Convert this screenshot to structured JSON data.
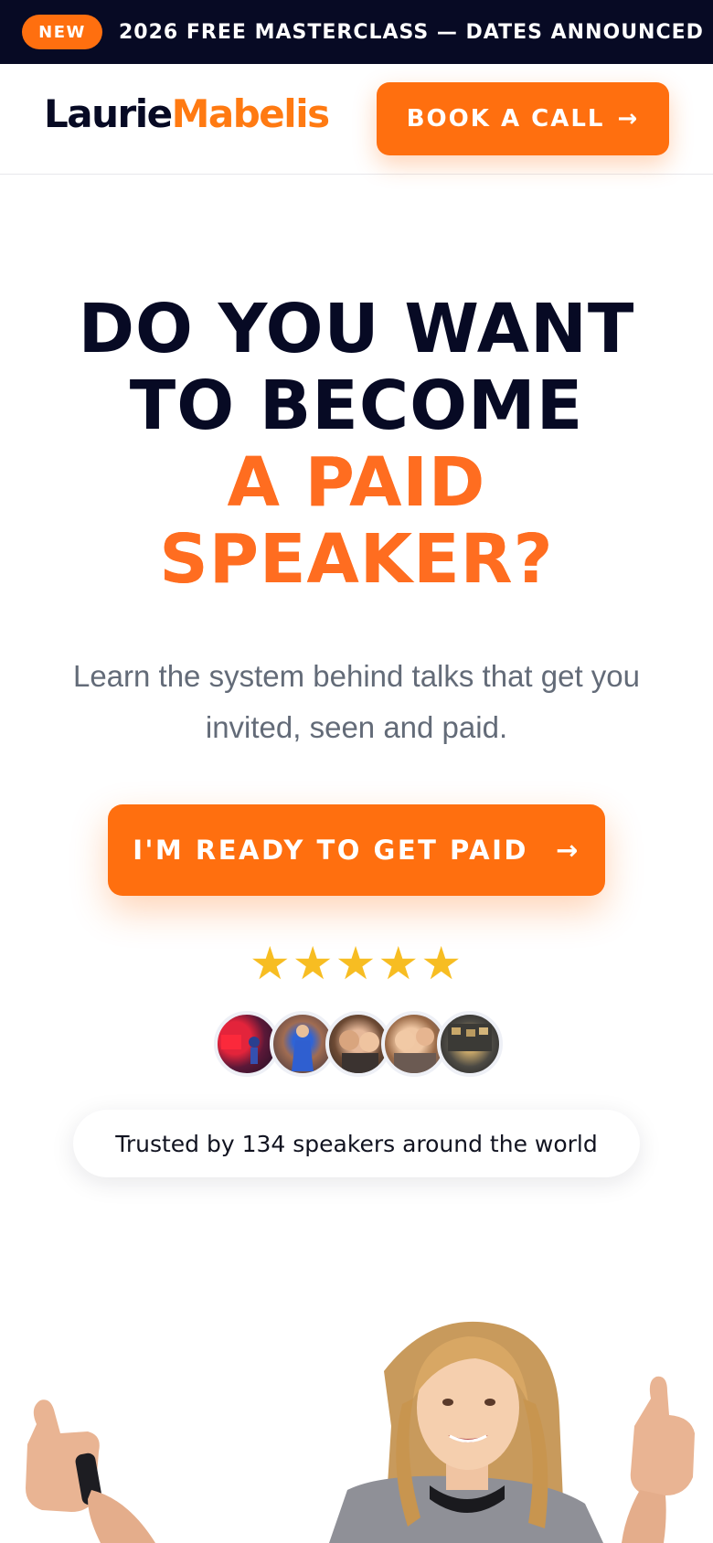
{
  "announcement": {
    "badge": "NEW",
    "text": "2026 FREE MASTERCLASS — DATES ANNOUNCED",
    "arrow": "→"
  },
  "header": {
    "logo_first": "Laurie",
    "logo_last": "Mabelis",
    "book_label": "BOOK A CALL",
    "book_arrow": "→"
  },
  "hero": {
    "headline_line1": "DO YOU WANT",
    "headline_line2": "TO BECOME",
    "headline_line3": "A PAID",
    "headline_line4": "SPEAKER?",
    "subtext": "Learn the system behind talks that get you invited, seen and paid.",
    "cta_label": "I'M READY TO GET PAID",
    "cta_arrow": "→",
    "rating_stars": 5,
    "star_glyph": "★",
    "trust_text": "Trusted by 134 speakers around the world"
  },
  "colors": {
    "brand_dark": "#070a24",
    "accent_orange": "#ff6f0f",
    "star_gold": "#f7bd22",
    "subtext_gray": "#636b78"
  }
}
